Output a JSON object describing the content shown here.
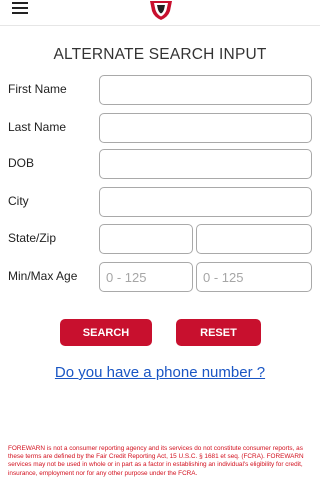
{
  "title": "ALTERNATE SEARCH INPUT",
  "colors": {
    "accent": "#c8102e",
    "link": "#1a56c4",
    "disclaimer": "#d2101e"
  },
  "icons": {
    "menu": "hamburger-icon",
    "logo": "forewarn-shield-logo"
  },
  "form": {
    "first_name": {
      "label": "First Name",
      "value": "",
      "placeholder": ""
    },
    "last_name": {
      "label": "Last Name",
      "value": "",
      "placeholder": ""
    },
    "dob": {
      "label": "DOB",
      "value": "",
      "placeholder": ""
    },
    "city": {
      "label": "City",
      "value": "",
      "placeholder": ""
    },
    "state_zip": {
      "label": "State/Zip",
      "state_value": "",
      "zip_value": ""
    },
    "age": {
      "label": "Min/Max Age",
      "min_placeholder": "0 - 125",
      "max_placeholder": "0 - 125"
    }
  },
  "buttons": {
    "search": "SEARCH",
    "reset": "RESET"
  },
  "phone_link": "Do you have a phone number ?",
  "disclaimer": "FOREWARN is not a consumer reporting agency and its services do not constitute consumer reports, as these terms are defined by the Fair Credit Reporting Act, 15 U.S.C. § 1681 et seq. (FCRA). FOREWARN services may not be used in whole or in part as a factor in establishing an individual's eligibility for credit, insurance, employment nor for any other purpose under the FCRA."
}
